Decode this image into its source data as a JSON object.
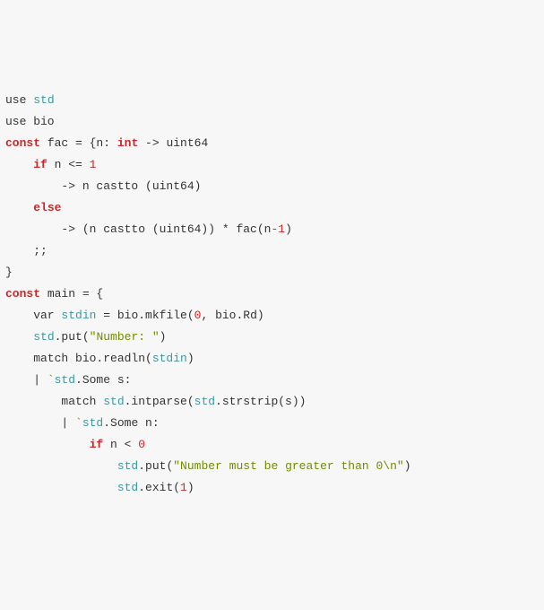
{
  "code": {
    "tokens": [
      [
        {
          "t": "use ",
          "c": "pl"
        },
        {
          "t": "std",
          "c": "fn"
        }
      ],
      [
        {
          "t": "use bio",
          "c": "pl"
        }
      ],
      [
        {
          "t": "",
          "c": "pl"
        }
      ],
      [
        {
          "t": "const",
          "c": "kw"
        },
        {
          "t": " fac = {n: ",
          "c": "pl"
        },
        {
          "t": "int",
          "c": "ty"
        },
        {
          "t": " -> uint64",
          "c": "pl"
        }
      ],
      [
        {
          "t": "    ",
          "c": "pl"
        },
        {
          "t": "if",
          "c": "kw"
        },
        {
          "t": " n <= ",
          "c": "pl"
        },
        {
          "t": "1",
          "c": "nm"
        }
      ],
      [
        {
          "t": "        -> n castto (uint64)",
          "c": "pl"
        }
      ],
      [
        {
          "t": "    ",
          "c": "pl"
        },
        {
          "t": "else",
          "c": "kw"
        }
      ],
      [
        {
          "t": "        -> (n castto (uint64)) * fac(n",
          "c": "pl"
        },
        {
          "t": "-",
          "c": "op"
        },
        {
          "t": "1",
          "c": "nm"
        },
        {
          "t": ")",
          "c": "pl"
        }
      ],
      [
        {
          "t": "    ;;",
          "c": "pl"
        }
      ],
      [
        {
          "t": "}",
          "c": "pl"
        }
      ],
      [
        {
          "t": "",
          "c": "pl"
        }
      ],
      [
        {
          "t": "const",
          "c": "kw"
        },
        {
          "t": " main = {",
          "c": "pl"
        }
      ],
      [
        {
          "t": "    var ",
          "c": "pl"
        },
        {
          "t": "stdin",
          "c": "id"
        },
        {
          "t": " = bio.mkfile(",
          "c": "pl"
        },
        {
          "t": "0",
          "c": "nm"
        },
        {
          "t": ", bio.Rd)",
          "c": "pl"
        }
      ],
      [
        {
          "t": "    ",
          "c": "pl"
        },
        {
          "t": "std",
          "c": "fn"
        },
        {
          "t": ".put(",
          "c": "pl"
        },
        {
          "t": "\"Number: \"",
          "c": "st"
        },
        {
          "t": ")",
          "c": "pl"
        }
      ],
      [
        {
          "t": "    match bio.readln(",
          "c": "pl"
        },
        {
          "t": "stdin",
          "c": "id"
        },
        {
          "t": ")",
          "c": "pl"
        }
      ],
      [
        {
          "t": "    | ",
          "c": "pl"
        },
        {
          "t": "`",
          "c": "st"
        },
        {
          "t": "std",
          "c": "fn"
        },
        {
          "t": ".Some s:",
          "c": "pl"
        }
      ],
      [
        {
          "t": "        match ",
          "c": "pl"
        },
        {
          "t": "std",
          "c": "fn"
        },
        {
          "t": ".intparse(",
          "c": "pl"
        },
        {
          "t": "std",
          "c": "fn"
        },
        {
          "t": ".strstrip(s))",
          "c": "pl"
        }
      ],
      [
        {
          "t": "        | ",
          "c": "pl"
        },
        {
          "t": "`",
          "c": "st"
        },
        {
          "t": "std",
          "c": "fn"
        },
        {
          "t": ".Some n:",
          "c": "pl"
        }
      ],
      [
        {
          "t": "            ",
          "c": "pl"
        },
        {
          "t": "if",
          "c": "kw"
        },
        {
          "t": " n < ",
          "c": "pl"
        },
        {
          "t": "0",
          "c": "nm"
        }
      ],
      [
        {
          "t": "                ",
          "c": "pl"
        },
        {
          "t": "std",
          "c": "fn"
        },
        {
          "t": ".put(",
          "c": "pl"
        },
        {
          "t": "\"Number must be greater than 0\\n\"",
          "c": "st"
        },
        {
          "t": ")",
          "c": "pl"
        }
      ],
      [
        {
          "t": "                ",
          "c": "pl"
        },
        {
          "t": "std",
          "c": "fn"
        },
        {
          "t": ".exit(",
          "c": "pl"
        },
        {
          "t": "1",
          "c": "nm"
        },
        {
          "t": ")",
          "c": "pl"
        }
      ]
    ]
  }
}
